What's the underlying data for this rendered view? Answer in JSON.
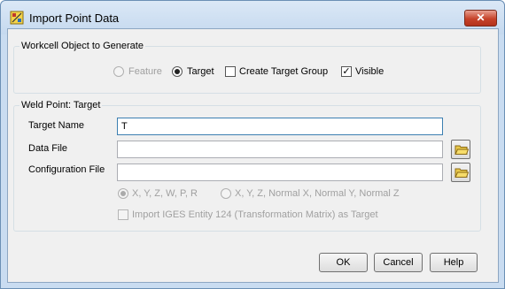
{
  "window": {
    "title": "Import Point Data",
    "close_label": "✕"
  },
  "group_generate": {
    "legend": "Workcell Object to Generate",
    "feature_label": "Feature",
    "target_label": "Target",
    "create_target_group_label": "Create Target Group",
    "visible_label": "Visible",
    "selected": "Target",
    "create_target_group_checked": false,
    "visible_checked": true
  },
  "group_weld": {
    "legend": "Weld Point: Target",
    "target_name_label": "Target Name",
    "target_name_value": "T",
    "data_file_label": "Data File",
    "data_file_value": "",
    "config_file_label": "Configuration File",
    "config_file_value": "",
    "format_opt1_label": "X, Y, Z, W, P, R",
    "format_opt2_label": "X, Y, Z, Normal X, Normal Y, Normal Z",
    "iges_label": "Import IGES Entity 124 (Transformation Matrix) as Target"
  },
  "buttons": {
    "ok": "OK",
    "cancel": "Cancel",
    "help": "Help"
  },
  "icons": {
    "app": "app-icon",
    "folder": "folder-open-icon",
    "close": "close-icon"
  }
}
